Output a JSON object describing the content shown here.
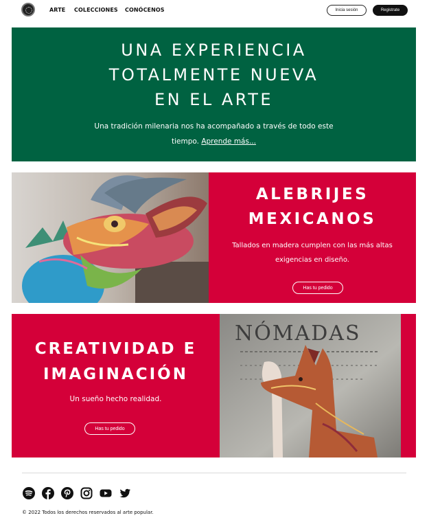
{
  "nav": {
    "links": [
      "ARTE",
      "COLECCIONES",
      "CONÓCENOS"
    ],
    "login_label": "Inicia sesión",
    "register_label": "Registrate"
  },
  "hero": {
    "title_lines": [
      "UNA EXPERIENCIA",
      "TOTALMENTE NUEVA",
      "EN EL ARTE"
    ],
    "text": "Una tradición milenaria nos ha acompañado a través de todo este tiempo.",
    "link": "Aprende más..."
  },
  "card1": {
    "title_lines": [
      "ALEBRIJES",
      "MEXICANOS"
    ],
    "text": "Tallados en madera cumplen con las más altas exigencias en diseño.",
    "button": "Has tu pedido"
  },
  "card2": {
    "title_lines": [
      "CREATIVIDAD E",
      "IMAGINACIÓN"
    ],
    "text": "Un sueño hecho realidad.",
    "button": "Has tu pedido",
    "image_text": "NÓMADAS"
  },
  "footer": {
    "socials": [
      "spotify-icon",
      "facebook-icon",
      "pinterest-icon",
      "instagram-icon",
      "youtube-icon",
      "twitter-icon"
    ],
    "copyright": "© 2022 Todos los derechos reservados al arte popular."
  },
  "colors": {
    "green": "#006241",
    "red": "#d40039"
  }
}
